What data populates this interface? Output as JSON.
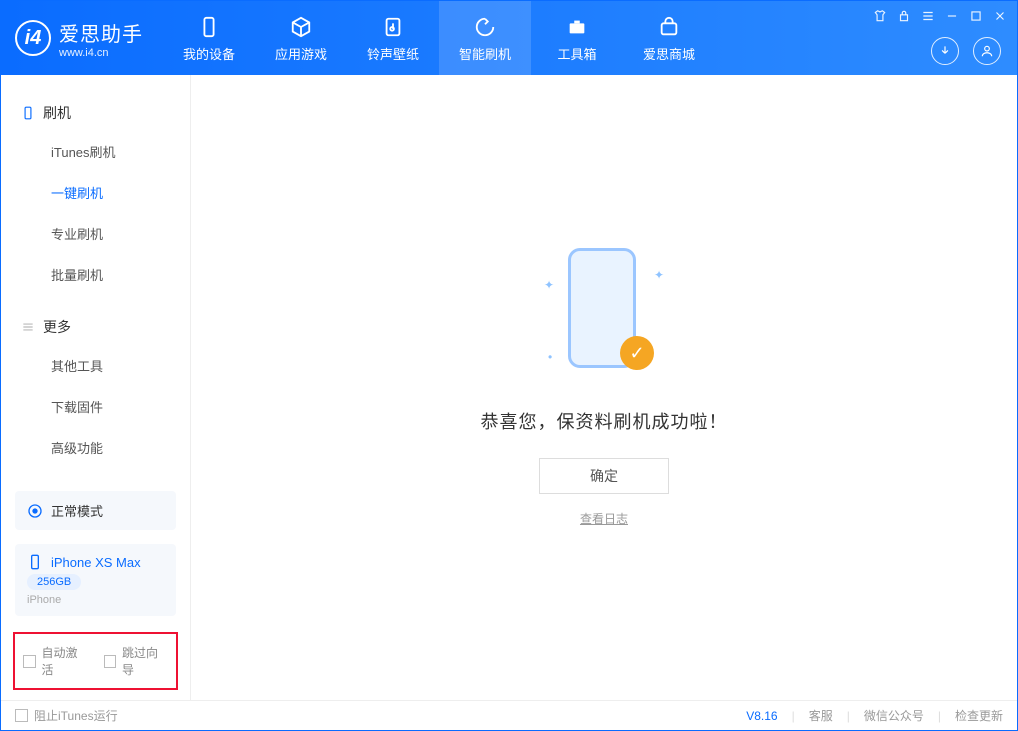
{
  "logo": {
    "cn": "爱思助手",
    "en": "www.i4.cn"
  },
  "nav": [
    {
      "label": "我的设备"
    },
    {
      "label": "应用游戏"
    },
    {
      "label": "铃声壁纸"
    },
    {
      "label": "智能刷机"
    },
    {
      "label": "工具箱"
    },
    {
      "label": "爱思商城"
    }
  ],
  "sidebar": {
    "section1": {
      "title": "刷机",
      "items": [
        "iTunes刷机",
        "一键刷机",
        "专业刷机",
        "批量刷机"
      ]
    },
    "section2": {
      "title": "更多",
      "items": [
        "其他工具",
        "下载固件",
        "高级功能"
      ]
    }
  },
  "mode_label": "正常模式",
  "device": {
    "name": "iPhone XS Max",
    "storage": "256GB",
    "type": "iPhone"
  },
  "checks": {
    "auto_activate": "自动激活",
    "skip_guide": "跳过向导"
  },
  "main": {
    "success": "恭喜您，保资料刷机成功啦！",
    "ok": "确定",
    "view_log": "查看日志"
  },
  "footer": {
    "block_itunes": "阻止iTunes运行",
    "version": "V8.16",
    "support": "客服",
    "wechat": "微信公众号",
    "update": "检查更新"
  }
}
